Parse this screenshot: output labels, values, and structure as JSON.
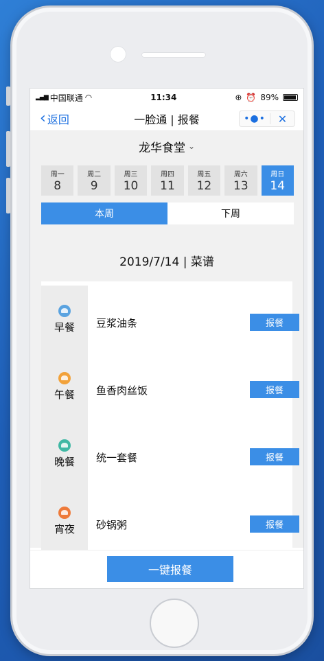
{
  "status": {
    "carrier": "中国联通",
    "time": "11:34",
    "battery": "89%"
  },
  "nav": {
    "back": "返回",
    "title": "一脸通 | 报餐",
    "more": "•●•",
    "close": "✕"
  },
  "canteen": {
    "name": "龙华食堂",
    "chevron": "⌄"
  },
  "days": [
    {
      "week": "周一",
      "date": "8"
    },
    {
      "week": "周二",
      "date": "9"
    },
    {
      "week": "周三",
      "date": "10"
    },
    {
      "week": "周四",
      "date": "11"
    },
    {
      "week": "周五",
      "date": "12"
    },
    {
      "week": "周六",
      "date": "13"
    },
    {
      "week": "周日",
      "date": "14"
    }
  ],
  "weeks": {
    "this": "本周",
    "next": "下周"
  },
  "menu_date": "2019/7/14 | 菜谱",
  "meals": [
    {
      "label": "早餐",
      "dish": "豆浆油条",
      "btn": "报餐",
      "color": "#5aa3e0",
      "icon": "sunrise-icon"
    },
    {
      "label": "午餐",
      "dish": "鱼香肉丝饭",
      "btn": "报餐",
      "color": "#f2a23a",
      "icon": "sun-icon"
    },
    {
      "label": "晚餐",
      "dish": "统一套餐",
      "btn": "报餐",
      "color": "#3fb8a4",
      "icon": "moon-icon"
    },
    {
      "label": "宵夜",
      "dish": "砂锅粥",
      "btn": "报餐",
      "color": "#ee7a3a",
      "icon": "night-snack-icon"
    }
  ],
  "bottom": {
    "one_key": "一键报餐"
  },
  "colors": {
    "accent": "#3b8ee6",
    "link": "#1b6fe0"
  }
}
